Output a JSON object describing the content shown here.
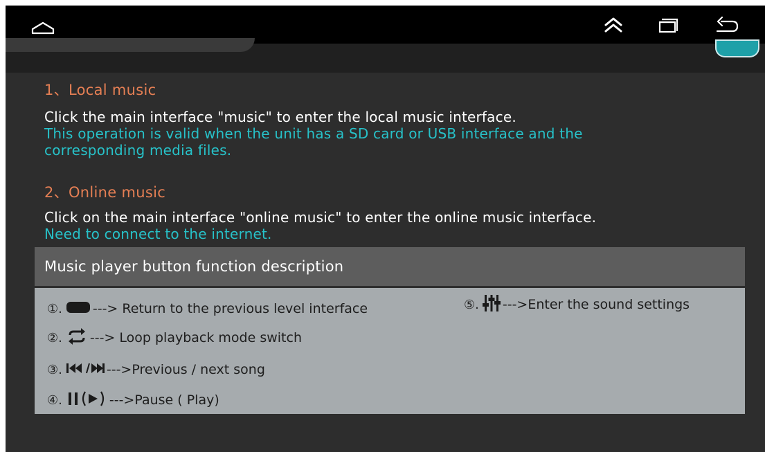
{
  "navbar": {
    "home_icon": "home-icon",
    "collapse_icon": "double-chevron-up-icon",
    "recents_icon": "recent-apps-icon",
    "back_icon": "back-arrow-icon"
  },
  "sections": [
    {
      "heading": "1、Local music",
      "line1": "Click the main interface \"music\" to enter the local music interface.",
      "note_line1": "This operation is valid when the unit has a SD card or USB interface and the",
      "note_line2": "corresponding media files."
    },
    {
      "heading": "2、Online music",
      "line1": "Click on the main interface \"online music\" to enter the online music interface.",
      "note_line1": "Need to connect to the internet."
    }
  ],
  "panel": {
    "title": "Music player button function description",
    "items": [
      {
        "num": "①.",
        "text": "--->  Return to the previous level interface",
        "icon": "back-pill-icon"
      },
      {
        "num": "⑤.",
        "text": "  --->Enter the sound settings",
        "icon": "equalizer-icon"
      },
      {
        "num": "②.",
        "text": "--->  Loop playback mode switch",
        "icon": "loop-icon"
      },
      {
        "num": "③.",
        "text": "--->Previous / next song",
        "icon": "prev-next-icon"
      },
      {
        "num": "④.",
        "text": "--->Pause  ( Play)",
        "icon": "pause-play-icon"
      }
    ]
  },
  "colors": {
    "background": "#2d2d2d",
    "navbar": "#000000",
    "heading": "#e57f54",
    "note": "#27c2c9",
    "panel_header": "#5d5d5d",
    "panel_body": "#a6abae"
  }
}
